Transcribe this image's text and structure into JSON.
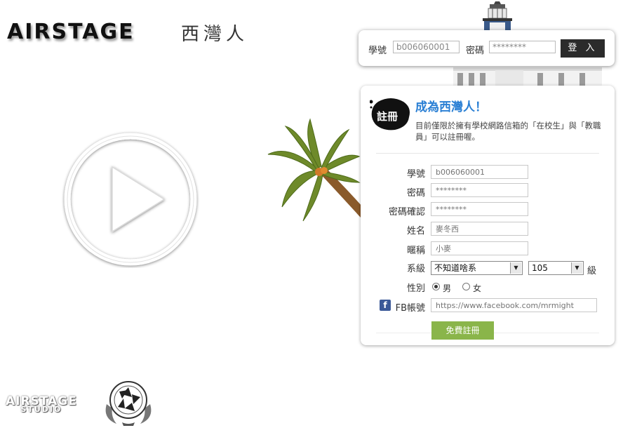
{
  "brand": {
    "logo": "AIRSTAGE",
    "logo_chinese": "西灣人"
  },
  "login": {
    "student_id_label": "學號",
    "student_id_value": "b006060001",
    "password_label": "密碼",
    "password_value": "********",
    "login_button": "登 入"
  },
  "register": {
    "badge": "註冊",
    "title": "成為西灣人！",
    "description": "目前僅限於擁有學校網路信箱的「在校生」與「教職員」可以註冊喔。",
    "fields": {
      "student_id": {
        "label": "學號",
        "placeholder": "b006060001"
      },
      "password": {
        "label": "密碼",
        "placeholder": "********"
      },
      "password_confirm": {
        "label": "密碼確認",
        "placeholder": "********"
      },
      "name": {
        "label": "姓名",
        "placeholder": "麥冬西"
      },
      "nickname": {
        "label": "暱稱",
        "placeholder": "小麥"
      },
      "department": {
        "label": "系級",
        "selected": "不知道啥系",
        "year": "105",
        "suffix": "級"
      },
      "gender": {
        "label": "性別",
        "male": "男",
        "female": "女",
        "selected": "male"
      },
      "facebook": {
        "label": "FB帳號",
        "placeholder": "https://www.facebook.com/mrmight"
      }
    },
    "submit": "免費註冊"
  },
  "footer": {
    "studio_top": "AIRSTAGE",
    "studio_bottom": "STUDIO"
  },
  "icons": {
    "play": "play-icon",
    "facebook": "facebook-icon"
  },
  "colors": {
    "title_blue": "#2a7fd4",
    "submit_green": "#8ab54a",
    "login_dark": "#2b2b2b",
    "facebook": "#3b5998"
  }
}
